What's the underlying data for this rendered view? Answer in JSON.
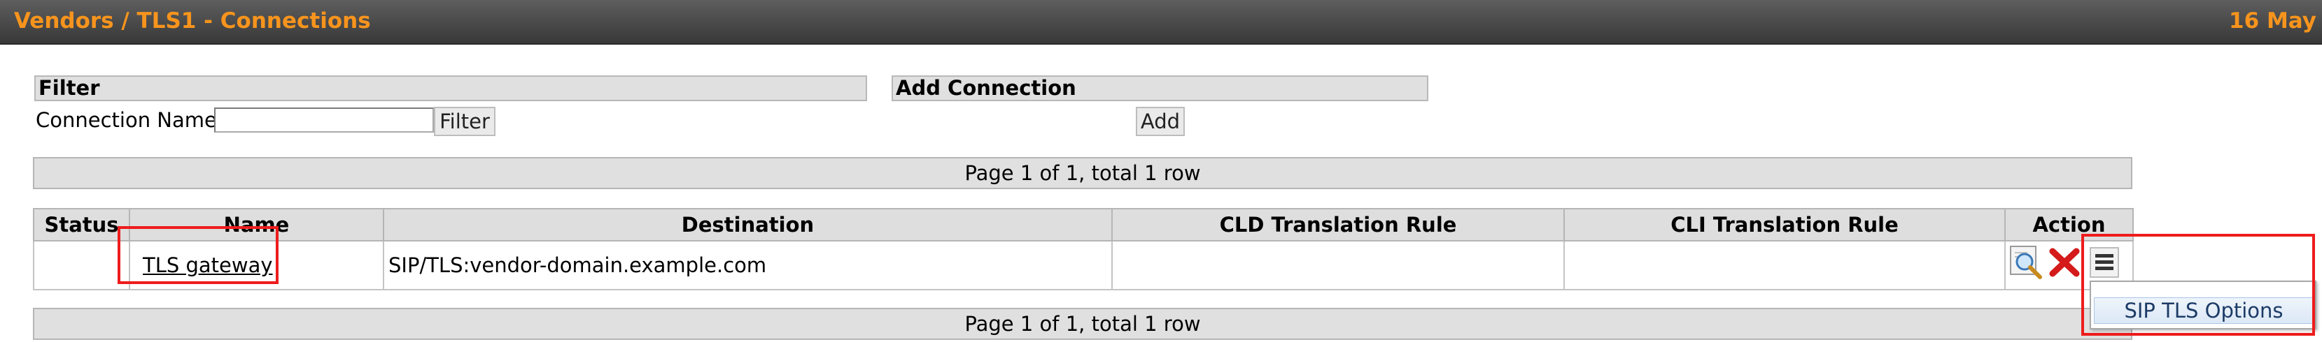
{
  "header": {
    "breadcrumb": {
      "vendors": "Vendors",
      "sep1": " / ",
      "vendor": "TLS1",
      "page": " - Connections"
    },
    "date": "16 May"
  },
  "filter": {
    "title": "Filter",
    "connection_name_label": "Connection Name",
    "connection_name_value": "",
    "button": "Filter"
  },
  "add_connection": {
    "title": "Add Connection",
    "button": "Add"
  },
  "pager": {
    "top": "Page 1 of 1, total 1 row",
    "bottom": "Page 1 of 1, total 1 row"
  },
  "table": {
    "columns": [
      "Status",
      "Name",
      "Destination",
      "CLD Translation Rule",
      "CLI Translation Rule",
      "Action"
    ],
    "rows": [
      {
        "status": "",
        "name": "TLS gateway",
        "destination": "SIP/TLS:vendor-domain.example.com",
        "cld_rule": "",
        "cli_rule": "",
        "actions": [
          "magnifier-icon",
          "delete-icon",
          "menu-icon"
        ]
      }
    ]
  },
  "action_menu": {
    "items": [
      "SIP TLS Options"
    ]
  },
  "colors": {
    "accent": "#f7941d",
    "highlight": "#ee1c1c",
    "header_bg": "#444444"
  }
}
